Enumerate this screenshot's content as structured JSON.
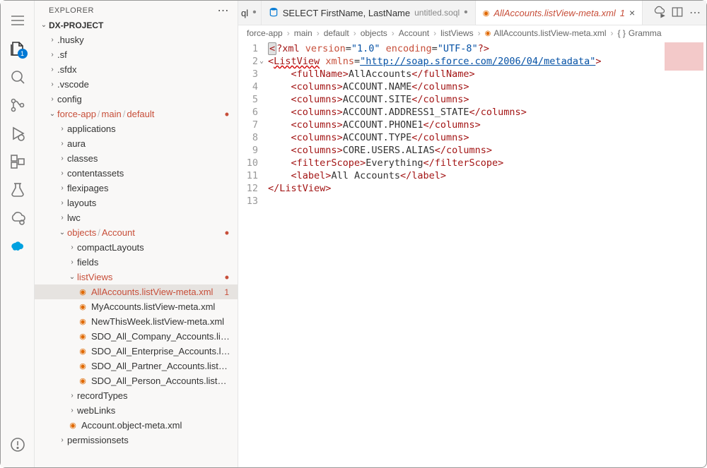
{
  "sidebar": {
    "header": "EXPLORER",
    "project": "DX-PROJECT",
    "tree": {
      "husky": ".husky",
      "sf": ".sf",
      "sfdx": ".sfdx",
      "vscode": ".vscode",
      "config": "config",
      "forceapp": "force-app",
      "forceapp_main": "main",
      "forceapp_default": "default",
      "applications": "applications",
      "aura": "aura",
      "classes": "classes",
      "contentassets": "contentassets",
      "flexipages": "flexipages",
      "layouts": "layouts",
      "lwc": "lwc",
      "objects": "objects",
      "account": "Account",
      "compactLayouts": "compactLayouts",
      "fields": "fields",
      "listViews": "listViews",
      "allAccounts": "AllAccounts.listView-meta.xml",
      "allAccountsBadge": "1",
      "myAccounts": "MyAccounts.listView-meta.xml",
      "newThisWeek": "NewThisWeek.listView-meta.xml",
      "sdoCompany": "SDO_All_Company_Accounts.listView...",
      "sdoEnterprise": "SDO_All_Enterprise_Accounts.listVie...",
      "sdoPartner": "SDO_All_Partner_Accounts.listView-...",
      "sdoPerson": "SDO_All_Person_Accounts.listView-...",
      "recordTypes": "recordTypes",
      "webLinks": "webLinks",
      "accountMeta": "Account.object-meta.xml",
      "permissionsets": "permissionsets"
    }
  },
  "tabs": {
    "partial_suffix": "ql",
    "soql_label": "SELECT FirstName, LastName",
    "soql_secondary": "untitled.soql",
    "active_label": "AllAccounts.listView-meta.xml",
    "active_badge": "1"
  },
  "breadcrumbs": {
    "parts": [
      "force-app",
      "main",
      "default",
      "objects",
      "Account",
      "listViews",
      "AllAccounts.listView-meta.xml",
      "Gramma"
    ],
    "p0": "force-app",
    "p1": "main",
    "p2": "default",
    "p3": "objects",
    "p4": "Account",
    "p5": "listViews",
    "p6": "AllAccounts.listView-meta.xml",
    "p7": "Gramma"
  },
  "code": {
    "xml_version": "\"1.0\"",
    "xml_encoding": "\"UTF-8\"",
    "xmlns": "\"http://soap.sforce.com/2006/04/metadata\"",
    "fullName": "AllAccounts",
    "col1": "ACCOUNT.NAME",
    "col2": "ACCOUNT.SITE",
    "col3": "ACCOUNT.ADDRESS1_STATE",
    "col4": "ACCOUNT.PHONE1",
    "col5": "ACCOUNT.TYPE",
    "col6": "CORE.USERS.ALIAS",
    "filterScope": "Everything",
    "label": "All Accounts"
  },
  "lines": {
    "l1": "1",
    "l2": "2",
    "l3": "3",
    "l4": "4",
    "l5": "5",
    "l6": "6",
    "l7": "7",
    "l8": "8",
    "l9": "9",
    "l10": "10",
    "l11": "11",
    "l12": "12",
    "l13": "13"
  }
}
